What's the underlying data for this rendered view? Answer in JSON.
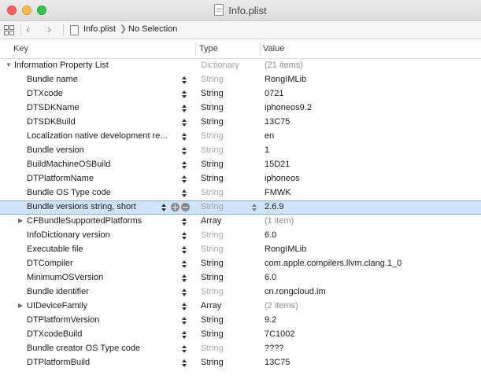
{
  "window": {
    "title": "Info.plist"
  },
  "jumpbar": {
    "file": "Info.plist",
    "selection": "No Selection"
  },
  "header": {
    "key": "Key",
    "type": "Type",
    "value": "Value"
  },
  "rows": [
    {
      "key": "Information Property List",
      "type": "Dictionary",
      "value": "(21 items)"
    },
    {
      "key": "Bundle name",
      "type": "String",
      "value": "RongIMLib"
    },
    {
      "key": "DTXcode",
      "type": "String",
      "value": "0721"
    },
    {
      "key": "DTSDKName",
      "type": "String",
      "value": "iphoneos9.2"
    },
    {
      "key": "DTSDKBuild",
      "type": "String",
      "value": "13C75"
    },
    {
      "key": "Localization native development re...",
      "type": "String",
      "value": "en"
    },
    {
      "key": "Bundle version",
      "type": "String",
      "value": "1"
    },
    {
      "key": "BuildMachineOSBuild",
      "type": "String",
      "value": "15D21"
    },
    {
      "key": "DTPlatformName",
      "type": "String",
      "value": "iphoneos"
    },
    {
      "key": "Bundle OS Type code",
      "type": "String",
      "value": "FMWK"
    },
    {
      "key": "Bundle versions string, short",
      "type": "String",
      "value": "2.6.9"
    },
    {
      "key": "CFBundleSupportedPlatforms",
      "type": "Array",
      "value": "(1 item)"
    },
    {
      "key": "InfoDictionary version",
      "type": "String",
      "value": "6.0"
    },
    {
      "key": "Executable file",
      "type": "String",
      "value": "RongIMLib"
    },
    {
      "key": "DTCompiler",
      "type": "String",
      "value": "com.apple.compilers.llvm.clang.1_0"
    },
    {
      "key": "MinimumOSVersion",
      "type": "String",
      "value": "6.0"
    },
    {
      "key": "Bundle identifier",
      "type": "String",
      "value": "cn.rongcloud.im"
    },
    {
      "key": "UIDeviceFamily",
      "type": "Array",
      "value": "(2 items)"
    },
    {
      "key": "DTPlatformVersion",
      "type": "String",
      "value": "9.2"
    },
    {
      "key": "DTXcodeBuild",
      "type": "String",
      "value": "7C1002"
    },
    {
      "key": "Bundle creator OS Type code",
      "type": "String",
      "value": "????"
    },
    {
      "key": "DTPlatformBuild",
      "type": "String",
      "value": "13C75"
    }
  ],
  "colors": {
    "selection": "#cfe4fb",
    "selection_border": "#7fb2ea"
  }
}
